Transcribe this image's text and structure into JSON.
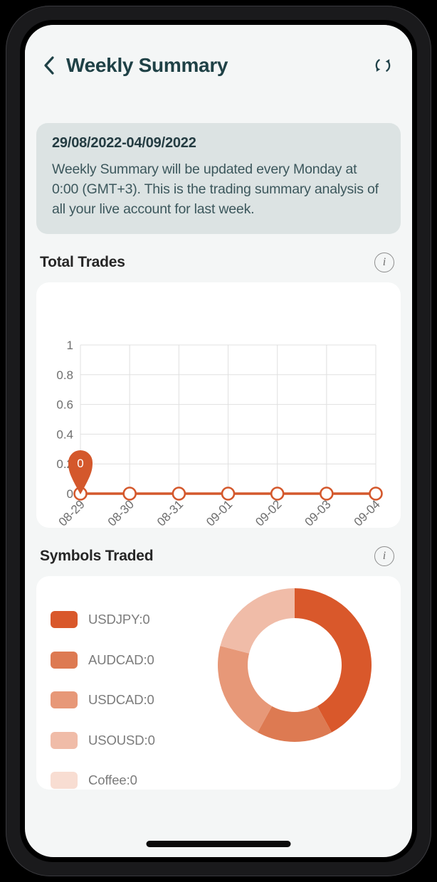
{
  "header": {
    "back_icon": "chevron-left-icon",
    "title": "Weekly Summary",
    "refresh_icon": "refresh-icon"
  },
  "info_card": {
    "date_range": "29/08/2022-04/09/2022",
    "description": "Weekly Summary will be updated every Monday at 0:00 (GMT+3). This is the trading summary analysis of all your live account for last week."
  },
  "sections": {
    "total_trades": {
      "title": "Total Trades",
      "info_icon": "info-icon",
      "info_glyph": "i"
    },
    "symbols_traded": {
      "title": "Symbols Traded",
      "info_icon": "info-icon",
      "info_glyph": "i"
    }
  },
  "colors": {
    "accent": "#d4582c",
    "header_text": "#1f4146",
    "background": "#f4f6f6",
    "info_card_bg": "#dce3e3",
    "card_bg": "#ffffff",
    "grid": "#e0e0e0",
    "axis_text": "#6e6e6e"
  },
  "chart_data": [
    {
      "type": "line",
      "title": "Total Trades",
      "categories": [
        "08-29",
        "08-30",
        "08-31",
        "09-01",
        "09-02",
        "09-03",
        "09-04"
      ],
      "values": [
        0,
        0,
        0,
        0,
        0,
        0,
        0
      ],
      "series": [
        {
          "name": "Total Trades",
          "values": [
            0,
            0,
            0,
            0,
            0,
            0,
            0
          ]
        }
      ],
      "xlabel": "",
      "ylabel": "",
      "ylim": [
        0,
        1
      ],
      "yticks": [
        "0",
        "0.2",
        "0.4",
        "0.6",
        "0.8",
        "1"
      ],
      "grid": true,
      "legend": "none",
      "line_color": "#d4582c",
      "marker": "open-circle",
      "annotation": {
        "label": "0",
        "at_category": "08-29",
        "style": "teardrop-pin",
        "color": "#d4582c"
      }
    },
    {
      "type": "pie",
      "title": "Symbols Traded",
      "donut": true,
      "labels": [
        "USDJPY:0",
        "AUDCAD:0",
        "USDCAD:0",
        "USOUSD:0",
        "Coffee:0"
      ],
      "names": [
        "USDJPY",
        "AUDCAD",
        "USDCAD",
        "USOUSD",
        "Coffee"
      ],
      "values": [
        0,
        0,
        0,
        0,
        0
      ],
      "display_fractions": [
        0.42,
        0.16,
        0.21,
        0.21,
        0.0
      ],
      "colors": [
        "#d9582b",
        "#dd7a52",
        "#e79878",
        "#f0bca8",
        "#f8ddd2"
      ],
      "legend": "left"
    }
  ],
  "legend_items": [
    {
      "label": "USDJPY:0",
      "color": "#d9582b"
    },
    {
      "label": "AUDCAD:0",
      "color": "#dd7a52"
    },
    {
      "label": "USDCAD:0",
      "color": "#e79878"
    },
    {
      "label": "USOUSD:0",
      "color": "#f0bca8"
    },
    {
      "label": "Coffee:0",
      "color": "#f8ddd2"
    }
  ],
  "system": {
    "home_indicator": "home-indicator"
  }
}
